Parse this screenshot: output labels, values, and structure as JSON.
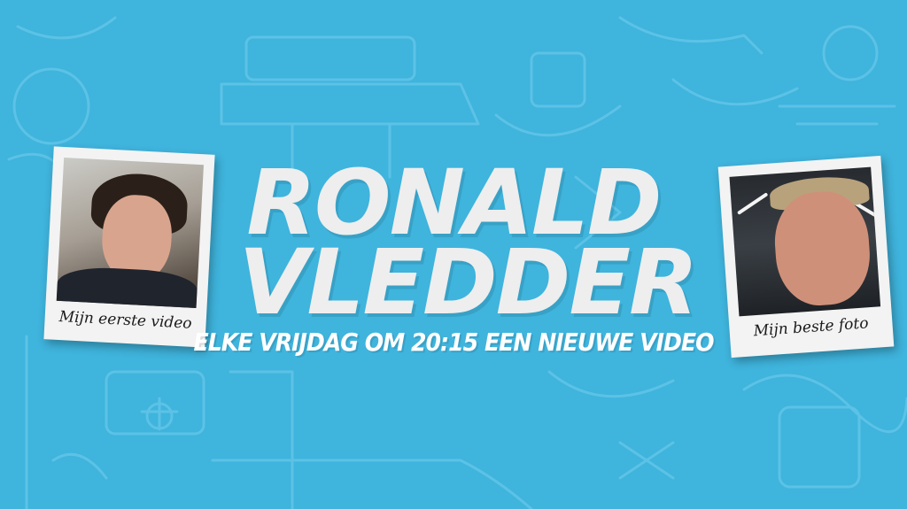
{
  "title": {
    "line1": "RONALD",
    "line2": "VLEDDER"
  },
  "tagline": "ELKE VRIJDAG OM 20:15 EEN NIEUWE VIDEO",
  "polaroids": {
    "left": {
      "caption": "Mijn  eerste video"
    },
    "right": {
      "caption": "Mijn beste foto"
    }
  },
  "colors": {
    "background": "#3fb4dd",
    "title": "#eeeeee",
    "tagline": "#ffffff",
    "doodle": "#5cc2e6"
  }
}
